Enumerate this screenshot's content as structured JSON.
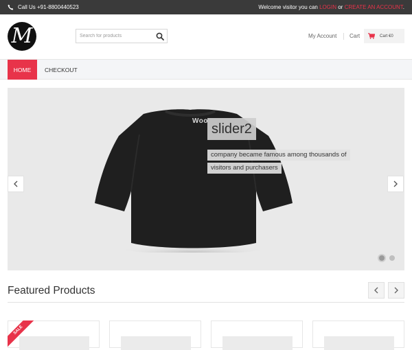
{
  "topbar": {
    "phone_text": "Call Us +91-8800440523",
    "welcome_prefix": "Welcome visitor you can ",
    "login_label": "LOGIN",
    "or_text": " or ",
    "create_label": "CREATE AN ACCOUNT",
    "end_text": "."
  },
  "header": {
    "logo_letter": "M",
    "search_placeholder": "Search for products",
    "account_label": "My Account",
    "cart_label": "Cart",
    "cart_total": "Cart €0"
  },
  "nav": {
    "items": [
      {
        "label": "HOME",
        "active": true
      },
      {
        "label": "CHECKOUT",
        "active": false
      }
    ]
  },
  "slider": {
    "shirt_print": "Woo",
    "caption_title": "slider2",
    "caption_line1": "company became famous among thousands of",
    "caption_line2": "visitors and purchasers",
    "slide_count": 2,
    "active_slide": 1
  },
  "featured": {
    "title": "Featured Products",
    "sale_badge": "SALE"
  },
  "icons": {
    "phone": "phone-icon",
    "search": "search-icon",
    "cart": "cart-icon",
    "prev": "chevron-left-icon",
    "next": "chevron-right-icon"
  },
  "colors": {
    "accent": "#e8334a",
    "topbar": "#3a3a3a",
    "nav_bg": "#f4f5f7"
  }
}
